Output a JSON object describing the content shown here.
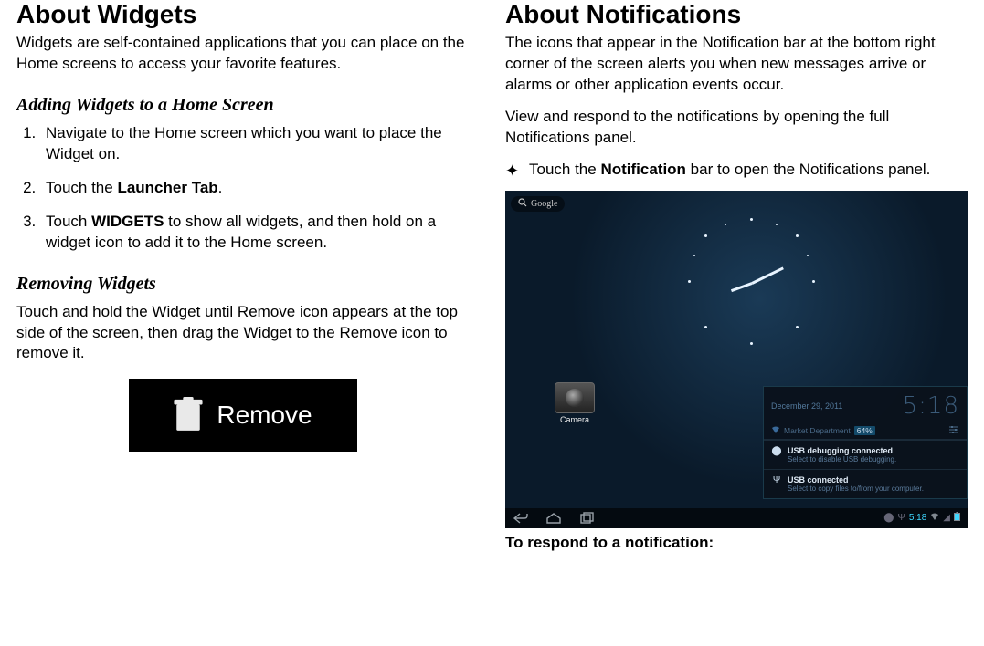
{
  "left": {
    "title": "About Widgets",
    "intro": "Widgets are self-contained applications that you can place on the Home screens to access your favorite features.",
    "adding_heading": "Adding Widgets to a Home Screen",
    "steps": {
      "s1": "Navigate to the Home screen which you want to place the Widget on.",
      "s2_pre": "Touch the ",
      "s2_bold": "Launcher Tab",
      "s2_post": ".",
      "s3_pre": "Touch ",
      "s3_bold": "WIDGETS",
      "s3_post": " to show all widgets, and then hold on a widget icon to add it to the Home screen."
    },
    "removing_heading": "Removing Widgets",
    "removing_text": "Touch and hold the Widget until Remove icon appears at the top side of the screen, then drag the Widget to the Remove icon to remove it.",
    "remove_label": "Remove"
  },
  "right": {
    "title": "About Notifications",
    "intro": "The icons that appear in the Notification bar at the bottom right corner of the screen alerts you when new messages arrive or alarms or other application events occur.",
    "para2": "View and respond to the notifications by opening the full Notifications panel.",
    "bullet_pre": "Touch the ",
    "bullet_bold": "Notification",
    "bullet_post": " bar to open the Notifications panel.",
    "screenshot": {
      "search_label": "Google",
      "camera_label": "Camera",
      "panel": {
        "date": "December 29, 2011",
        "time": "5:18",
        "wifi_name": "Market Department",
        "wifi_pct": "64%",
        "item1_title": "USB debugging connected",
        "item1_sub": "Select to disable USB debugging.",
        "item2_title": "USB connected",
        "item2_sub": "Select to copy files to/from your computer."
      },
      "status_time": "5:18"
    },
    "respond_heading": "To respond to a notification:"
  }
}
